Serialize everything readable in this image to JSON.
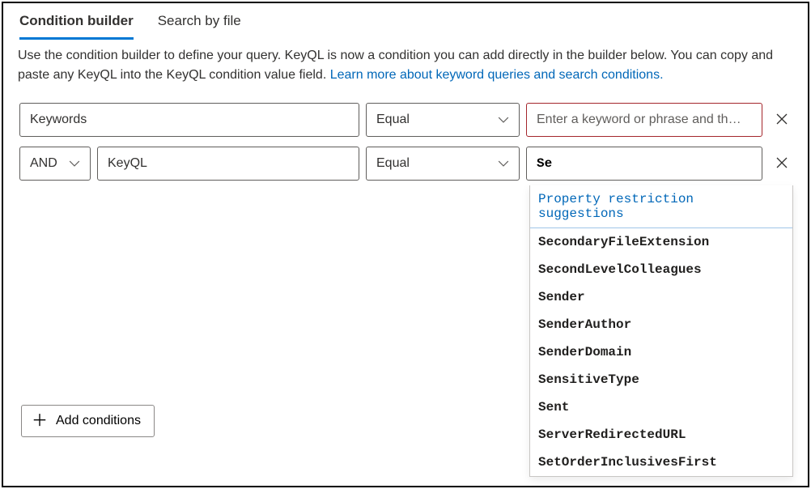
{
  "tabs": {
    "conditionBuilder": "Condition builder",
    "searchByFile": "Search by file"
  },
  "description": {
    "text": "Use the condition builder to define your query. KeyQL is now a condition you can add directly in the builder below. You can copy and paste any KeyQL into the KeyQL condition value field. ",
    "linkText": "Learn more about keyword queries and search conditions."
  },
  "row1": {
    "field": "Keywords",
    "operator": "Equal",
    "placeholder": "Enter a keyword or phrase and th…"
  },
  "row2": {
    "logic": "AND",
    "field": "KeyQL",
    "operator": "Equal",
    "value": "Se"
  },
  "addButton": "Add conditions",
  "suggestions": {
    "header": "Property restriction suggestions",
    "items": [
      "SecondaryFileExtension",
      "SecondLevelColleagues",
      "Sender",
      "SenderAuthor",
      "SenderDomain",
      "SensitiveType",
      "Sent",
      "ServerRedirectedURL",
      "SetOrderInclusivesFirst"
    ]
  }
}
